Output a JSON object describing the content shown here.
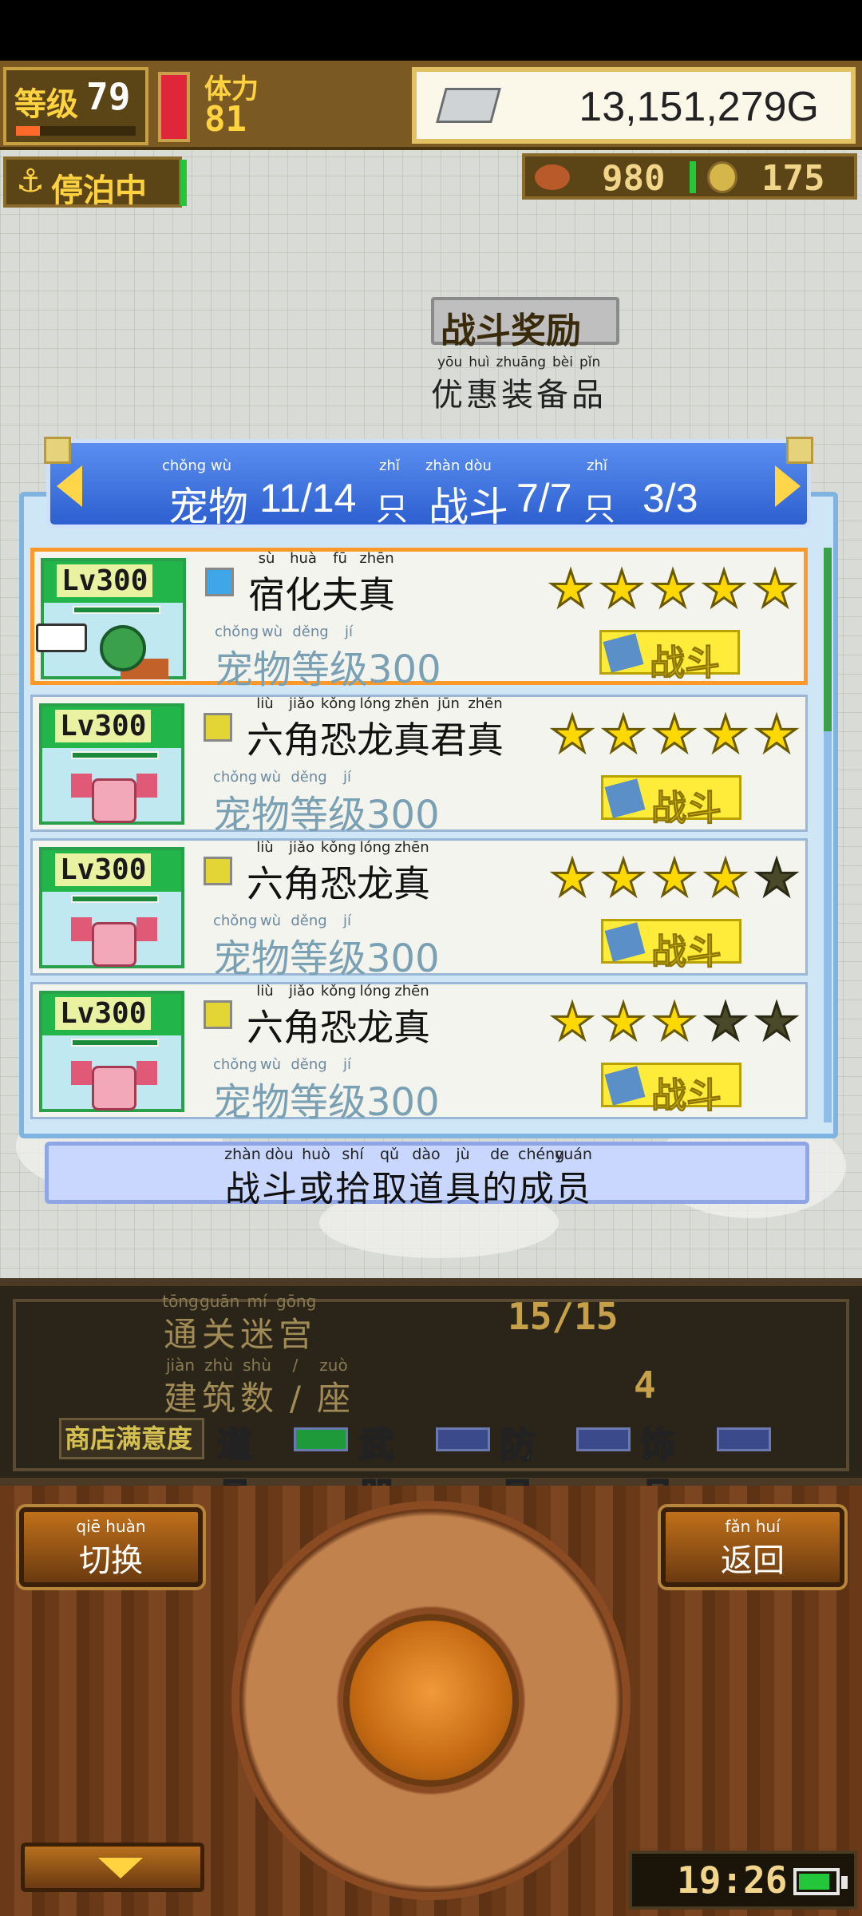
{
  "hud": {
    "level_label": "等级",
    "level_value": "79",
    "level_progress": 0.2,
    "stamina_label": "体力",
    "stamina_value": "81",
    "gold": "13,151,279G",
    "status_label": "停泊中",
    "food_value": "980",
    "coin_value": "175"
  },
  "building": {
    "sign": "战斗奖励",
    "ruby": [
      "yōu",
      "huì",
      "zhuāng",
      "bèi",
      "pǐn"
    ],
    "name": "优惠装备品"
  },
  "pet_header": {
    "pet_ruby": "chǒng wù",
    "pet_label": "宠物",
    "pet_count": "11/14",
    "unit_ruby": "zhǐ",
    "unit": "只",
    "battle_ruby": "zhàn dòu",
    "battle_label": "战斗",
    "battle_count": "7/7",
    "extra_count": "3/3"
  },
  "pets": [
    {
      "name_chars": [
        "宿",
        "化",
        "夫",
        "真"
      ],
      "name_ruby": [
        "sù",
        "huà",
        "fū",
        "zhēn"
      ],
      "level_badge": "Lv300",
      "level_ruby": [
        "chǒng",
        "wù",
        "děng",
        "jí"
      ],
      "level_words": [
        "宠",
        "物",
        "等",
        "级"
      ],
      "level": "300",
      "stars": 5,
      "battle_label": "战斗"
    },
    {
      "name_chars": [
        "六",
        "角",
        "恐",
        "龙",
        "真",
        "君",
        "真"
      ],
      "name_ruby": [
        "liù",
        "jiǎo",
        "kǒng",
        "lóng",
        "zhēn",
        "jūn",
        "zhēn"
      ],
      "level_badge": "Lv300",
      "level_ruby": [
        "chǒng",
        "wù",
        "děng",
        "jí"
      ],
      "level_words": [
        "宠",
        "物",
        "等",
        "级"
      ],
      "level": "300",
      "stars": 5,
      "battle_label": "战斗"
    },
    {
      "name_chars": [
        "六",
        "角",
        "恐",
        "龙",
        "真"
      ],
      "name_ruby": [
        "liù",
        "jiǎo",
        "kǒng",
        "lóng",
        "zhēn"
      ],
      "level_badge": "Lv300",
      "level_ruby": [
        "chǒng",
        "wù",
        "děng",
        "jí"
      ],
      "level_words": [
        "宠",
        "物",
        "等",
        "级"
      ],
      "level": "300",
      "stars": 4,
      "battle_label": "战斗"
    },
    {
      "name_chars": [
        "六",
        "角",
        "恐",
        "龙",
        "真"
      ],
      "name_ruby": [
        "liù",
        "jiǎo",
        "kǒng",
        "lóng",
        "zhēn"
      ],
      "level_badge": "Lv300",
      "level_ruby": [
        "chǒng",
        "wù",
        "děng",
        "jí"
      ],
      "level_words": [
        "宠",
        "物",
        "等",
        "级"
      ],
      "level": "300",
      "stars": 3,
      "battle_label": "战斗"
    }
  ],
  "info": {
    "ruby": [
      "zhàn",
      "dòu",
      "huò",
      "shí",
      "qǔ",
      "dào",
      "jù",
      "de",
      "chéng",
      "yuán"
    ],
    "chars": [
      "战",
      "斗",
      "或",
      "拾",
      "取",
      "道",
      "具",
      "的",
      "成",
      "员"
    ]
  },
  "stats": {
    "maze_ruby": [
      "tōng",
      "guān",
      "mí",
      "gōng"
    ],
    "maze_chars": [
      "通",
      "关",
      "迷",
      "宫"
    ],
    "maze_value": "15/15",
    "building_ruby": [
      "jiàn",
      "zhù",
      "shù",
      "/",
      "zuò"
    ],
    "building_chars": [
      "建",
      "筑",
      "数",
      "/",
      "座"
    ],
    "building_value": "4",
    "satisfaction_label": "商店满意度",
    "categories": [
      "道具",
      "武器",
      "防具",
      "饰品"
    ]
  },
  "controls": {
    "switch_ruby": "qiē huàn",
    "switch_label": "切换",
    "back_ruby": "fǎn huí",
    "back_label": "返回",
    "clock": "19:26"
  },
  "colors": {
    "header_blue": "#2d5fd0",
    "selected_border": "#ff9a2a",
    "star_on": "#ffd800",
    "star_off": "#4a4a2a",
    "battle_yellow": "#ffec3a"
  }
}
